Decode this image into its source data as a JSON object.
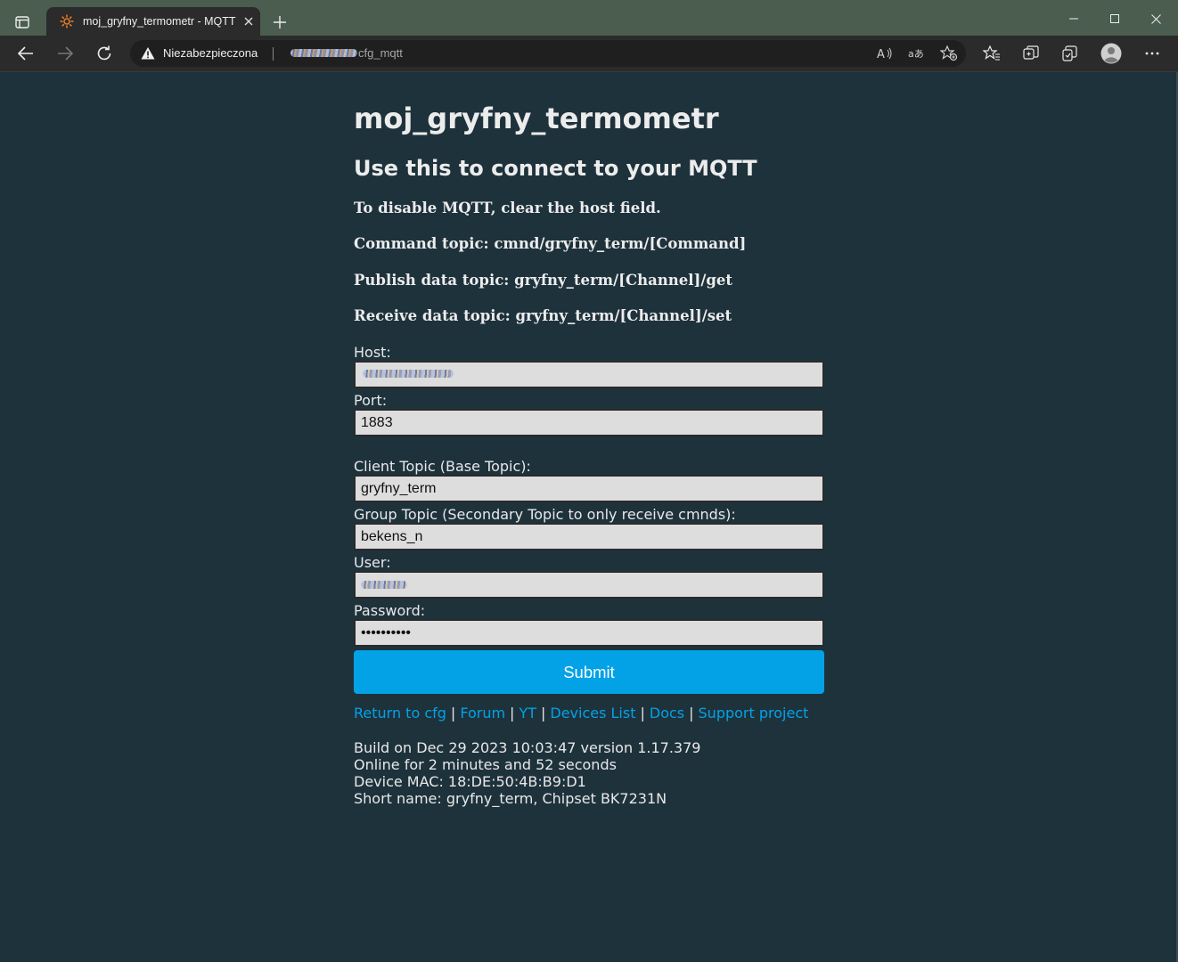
{
  "browser": {
    "tab_title": "moj_gryfny_termometr - MQTT",
    "security_label": "Niezabezpieczona",
    "url_path": "cfg_mqtt",
    "icons": {
      "sidebar": "tab-actions-icon",
      "favicon": "gear-favicon-icon",
      "back": "back-arrow-icon",
      "forward": "forward-arrow-icon",
      "reload": "reload-icon",
      "warning": "warning-triangle-icon",
      "read_aloud": "read-aloud-icon",
      "translate": "translate-icon",
      "add_favorite": "add-favorite-icon",
      "favorites": "favorites-icon",
      "collections": "collections-icon",
      "extensions": "browser-essentials-icon",
      "profile": "profile-avatar-icon",
      "more": "more-dots-icon"
    }
  },
  "page": {
    "title": "moj_gryfny_termometr",
    "subtitle": "Use this to connect to your MQTT",
    "info": [
      "To disable MQTT, clear the host field.",
      "Command topic: cmnd/gryfny_term/[Command]",
      "Publish data topic: gryfny_term/[Channel]/get",
      "Receive data topic: gryfny_term/[Channel]/set"
    ],
    "form": {
      "host_label": "Host:",
      "host_value": "",
      "port_label": "Port:",
      "port_value": "1883",
      "client_topic_label": "Client Topic (Base Topic):",
      "client_topic_value": "gryfny_term",
      "group_topic_label": "Group Topic (Secondary Topic to only receive cmnds):",
      "group_topic_value": "bekens_n",
      "user_label": "User:",
      "user_value": "",
      "password_label": "Password:",
      "password_value": "••••••••••",
      "submit_label": "Submit"
    },
    "links": {
      "return": "Return to cfg",
      "forum": "Forum",
      "yt": "YT",
      "devices": "Devices List",
      "docs": "Docs",
      "support": "Support project",
      "separator": "|"
    },
    "footer": {
      "build": "Build on Dec 29 2023 10:03:47 version 1.17.379",
      "online": "Online for 2 minutes and 52 seconds",
      "mac": "Device MAC: 18:DE:50:4B:B9:D1",
      "short_name": "Short name: gryfny_term, Chipset BK7231N"
    }
  },
  "colors": {
    "page_background": "#1e323c",
    "accent": "#03a2e6",
    "titlebar": "#4a5d4f",
    "toolbar": "#2b2b2b"
  }
}
